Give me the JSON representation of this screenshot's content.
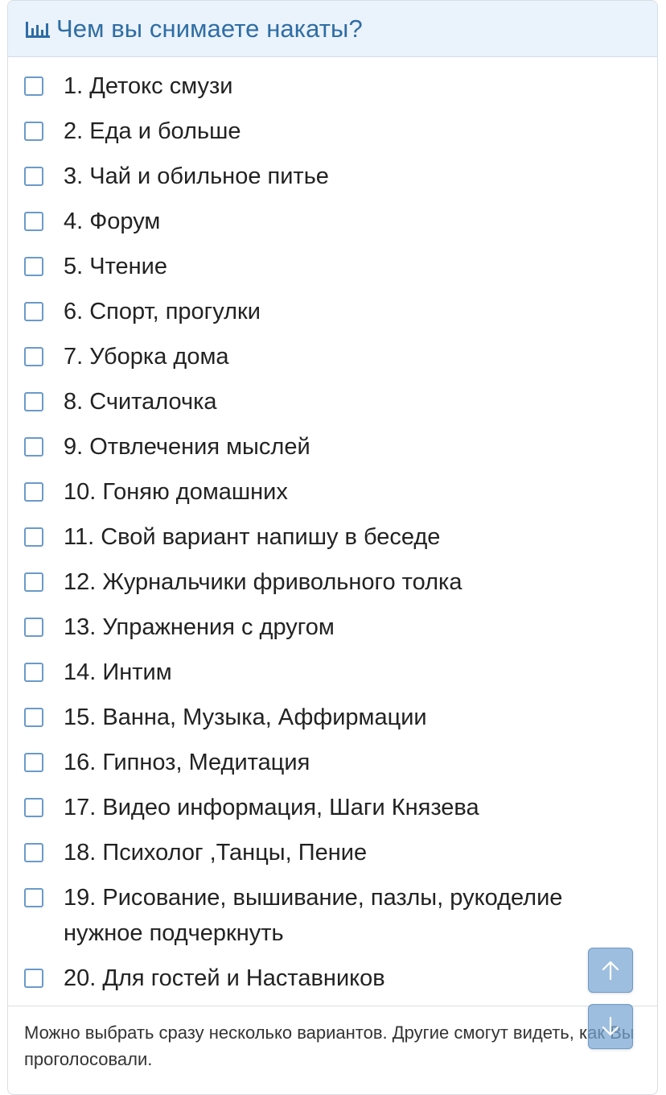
{
  "poll": {
    "title": "Чем вы снимаете накаты?",
    "icon": "bar-chart-icon",
    "accent_color": "#2e6da4",
    "header_background": "#eaf2fb",
    "options": [
      "1. Детокс смузи",
      "2. Еда и больше",
      "3. Чай и обильное питье",
      "4. Форум",
      "5. Чтение",
      "6. Спорт, прогулки",
      "7. Уборка дома",
      "8. Считалочка",
      "9. Отвлечения мыслей",
      "10. Гоняю домашних",
      "11. Свой вариант напишу в беседе",
      "12. Журнальчики фривольного толка",
      "13. Упражнения с другом",
      "14. Интим",
      "15. Ванна, Музыка, Аффирмации",
      "16. Гипноз, Медитация",
      "17. Видео информация, Шаги Князева",
      "18. Психолог ,Танцы, Пение",
      "19. Рисование, вышивание, пазлы, рукоделие нужное подчеркнуть",
      "20. Для гостей и Наставников"
    ],
    "footer": "Можно выбрать сразу несколько вариантов. Другие смогут видеть, как Вы проголосовали."
  },
  "scroll_buttons": {
    "up_icon": "arrow-up-icon",
    "down_icon": "arrow-down-icon"
  }
}
